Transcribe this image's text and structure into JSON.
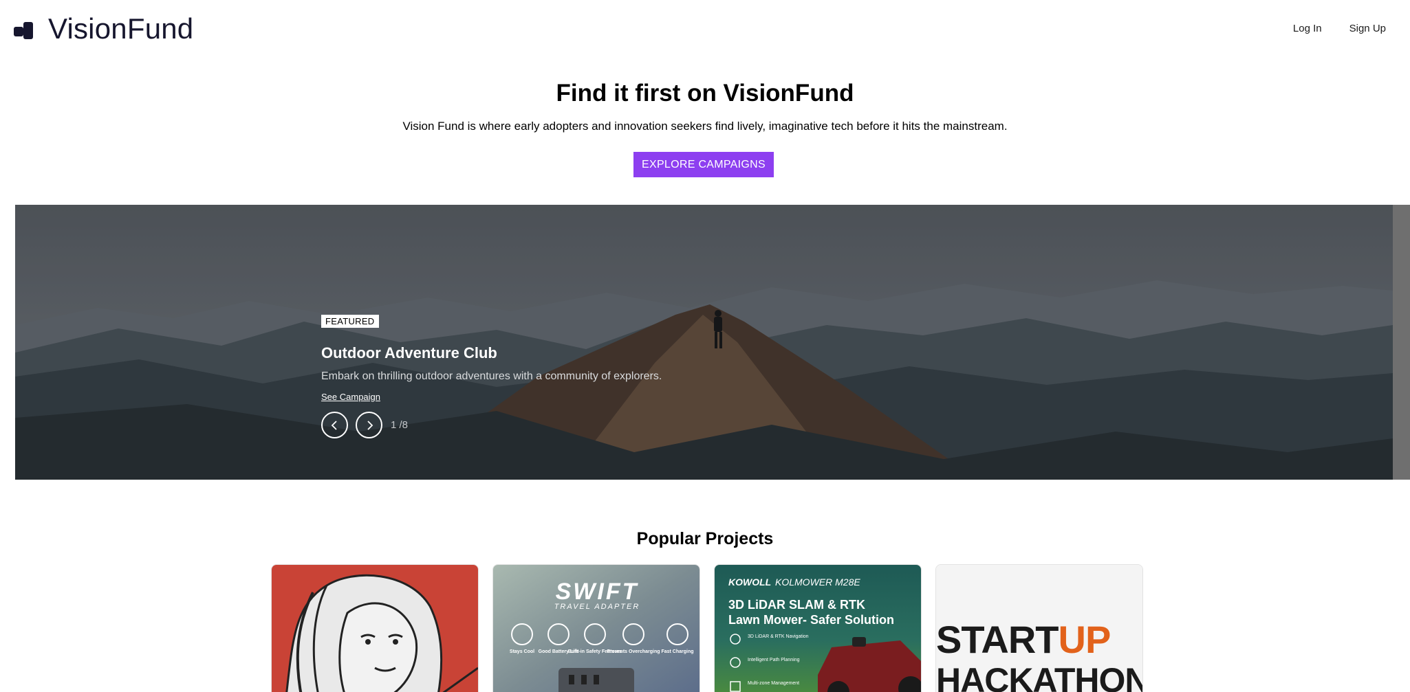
{
  "brand": {
    "name": "VisionFund"
  },
  "nav": {
    "login": "Log In",
    "signup": "Sign Up"
  },
  "hero": {
    "title": "Find it first on VisionFund",
    "subtitle": "Vision Fund is where early adopters and innovation seekers find lively, imaginative tech before it hits the mainstream.",
    "cta": "EXPLORE CAMPAIGNS"
  },
  "featured": {
    "badge": "FEATURED",
    "title": "Outdoor Adventure Club",
    "description": "Embark on thrilling outdoor adventures with a community of explorers.",
    "link": "See Campaign",
    "counter": "1 /8"
  },
  "popular": {
    "title": "Popular Projects",
    "cards": [
      {
        "id": "art"
      },
      {
        "brand": "SWIFT",
        "tagline": "TRAVEL ADAPTER",
        "features": [
          "Stays Cool",
          "Good Battery Life",
          "Built-in Safety Features",
          "Prevents Overcharging",
          "Fast Charging"
        ]
      },
      {
        "brand": "KOWOLL",
        "model": "KOLMOWER M28E",
        "headline1": "3D LiDAR SLAM & RTK",
        "headline2": "Lawn Mower- Safer Solution",
        "features": [
          "3D LiDAR & RTK Navigation",
          "Intelligent Path Planning",
          "Multi-zone Management"
        ]
      },
      {
        "word1": "START",
        "word1b": "UP",
        "word2": "HACKATHON"
      }
    ]
  },
  "colors": {
    "accent": "#8d3ff0",
    "brand_dark": "#16162e"
  }
}
